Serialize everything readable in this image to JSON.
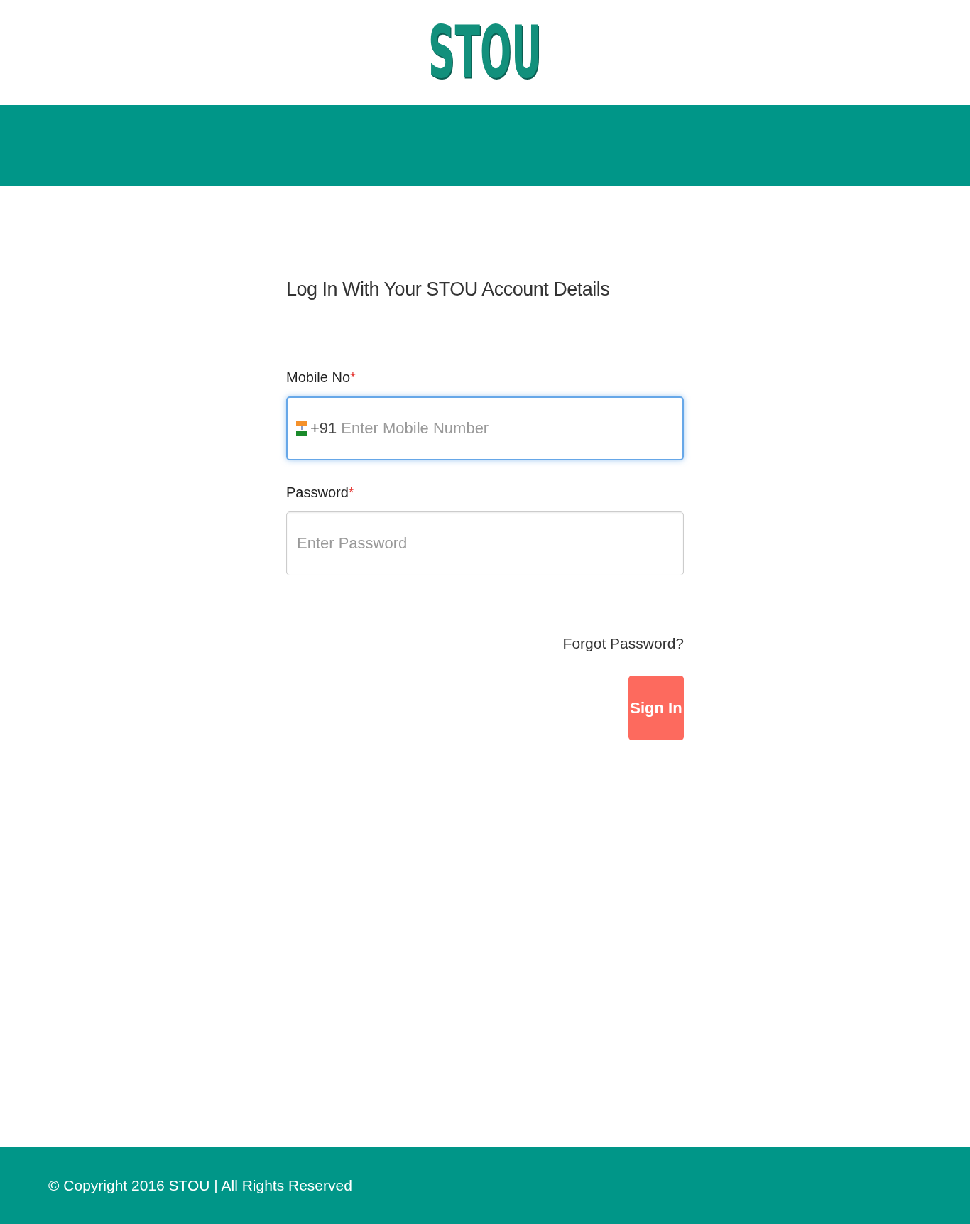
{
  "logo": {
    "text": "STOU"
  },
  "form": {
    "title": "Log In With Your STOU Account Details",
    "fields": [
      {
        "kind": "phone",
        "label": "Mobile No",
        "required": true,
        "required_mark": "*",
        "country_code": "+91",
        "placeholder": "Enter Mobile Number",
        "focused": true
      },
      {
        "kind": "password",
        "label": "Password",
        "required": true,
        "required_mark": "*",
        "placeholder": "Enter Password",
        "focused": false
      }
    ],
    "forgot_link": "Forgot Password?",
    "submit_button": "Sign In"
  },
  "footer": {
    "text": "© Copyright 2016 STOU | All Rights Reserved"
  }
}
